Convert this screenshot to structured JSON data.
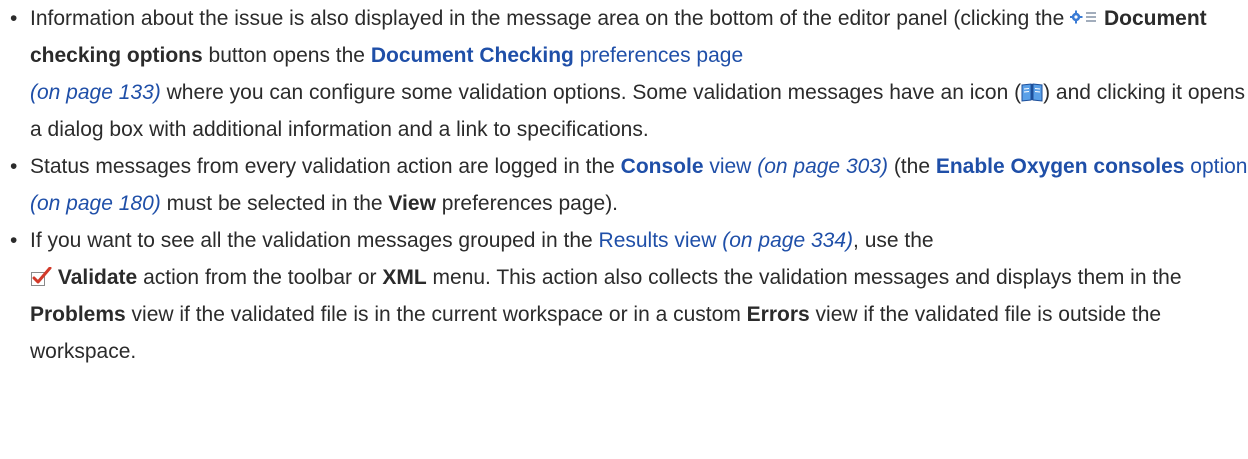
{
  "items": [
    {
      "t1": "Information about the issue is also displayed in the message area on the bottom of the editor panel (clicking the ",
      "btn_label": "Document checking options",
      "t2": " button opens the ",
      "link1": "Document Checking",
      "link1_tail": " preferences page",
      "ref1": "(on page 133)",
      "t3": " where you can configure some validation options. Some validation messages have an icon (",
      "t4": ") and clicking it opens a dialog box with additional information and a link to specifications."
    },
    {
      "t1": "Status messages from every validation action are logged in the ",
      "link1": "Console",
      "link1_tail": " view",
      "ref1": "(on page 303)",
      "t2": " (the ",
      "link2": "Enable Oxygen consoles",
      "link2_tail": " option",
      "ref2": "(on page 180)",
      "t3": " must be selected in the ",
      "view_label": "View",
      "t4": " preferences page)."
    },
    {
      "t1": "If you want to see all the validation messages grouped in the ",
      "link1": "Results view",
      "ref1": "(on page 334)",
      "t2": ", use the ",
      "validate_label": "Validate",
      "t3": " action from the toolbar or ",
      "xml_label": "XML",
      "t4": " menu. This action also collects the validation messages and displays them in the ",
      "problems_label": "Problems",
      "t5": " view if the validated file is in the current workspace or in a custom ",
      "errors_label": "Errors",
      "t6": " view if the validated file is outside the workspace."
    }
  ],
  "icons": {
    "item0_button": "document-checking-options-icon",
    "item0_message": "additional-info-book-icon",
    "item2_validate": "validate-checkmark-icon"
  },
  "colors": {
    "text": "#2b2b2b",
    "link": "#1f4fa8",
    "icon_blue": "#3a7bd5",
    "check_red": "#d23a2a"
  }
}
